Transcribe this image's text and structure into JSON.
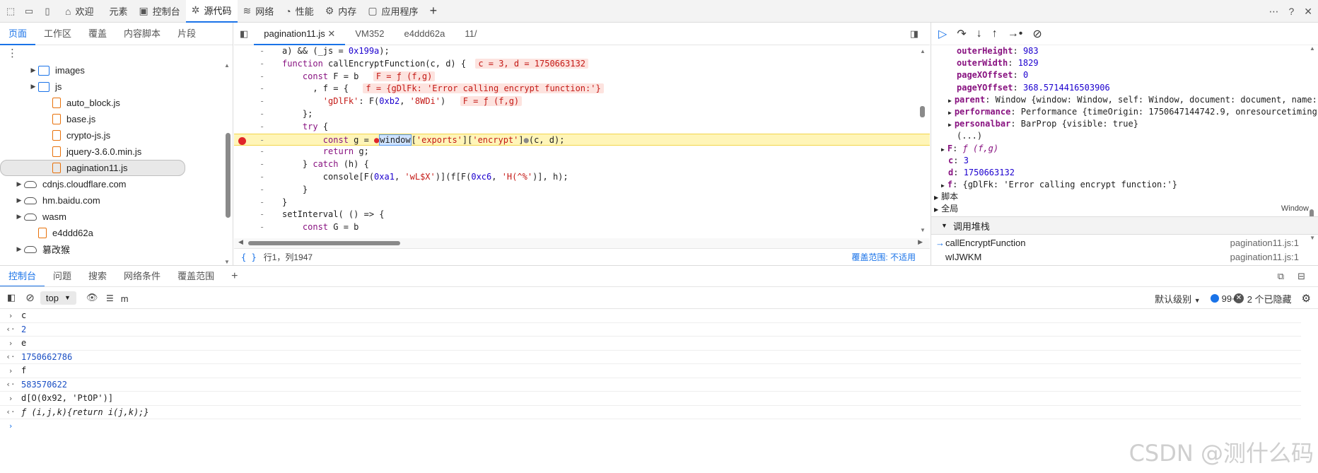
{
  "topbar": {
    "tabs": [
      {
        "label": "欢迎",
        "icon": "home-icon"
      },
      {
        "label": "元素",
        "icon": "code-icon"
      },
      {
        "label": "控制台",
        "icon": "console-icon"
      },
      {
        "label": "源代码",
        "icon": "bug-icon",
        "active": true
      },
      {
        "label": "网络",
        "icon": "wifi-icon"
      },
      {
        "label": "性能",
        "icon": "gauge-icon"
      },
      {
        "label": "内存",
        "icon": "memory-icon"
      },
      {
        "label": "应用程序",
        "icon": "app-icon"
      }
    ]
  },
  "navigator": {
    "tabs": [
      "页面",
      "工作区",
      "覆盖",
      "内容脚本",
      "片段"
    ],
    "tree": [
      {
        "label": "images",
        "type": "folder",
        "indent": 2,
        "arrow": "▶"
      },
      {
        "label": "js",
        "type": "folder",
        "indent": 2,
        "arrow": "▶"
      },
      {
        "label": "auto_block.js",
        "type": "file",
        "indent": 3,
        "arrow": ""
      },
      {
        "label": "base.js",
        "type": "file",
        "indent": 3,
        "arrow": ""
      },
      {
        "label": "crypto-js.js",
        "type": "file",
        "indent": 3,
        "arrow": ""
      },
      {
        "label": "jquery-3.6.0.min.js",
        "type": "file",
        "indent": 3,
        "arrow": ""
      },
      {
        "label": "pagination11.js",
        "type": "file",
        "indent": 3,
        "arrow": "",
        "selected": true
      },
      {
        "label": "cdnjs.cloudflare.com",
        "type": "cloud",
        "indent": 1,
        "arrow": "▶"
      },
      {
        "label": "hm.baidu.com",
        "type": "cloud",
        "indent": 1,
        "arrow": "▶"
      },
      {
        "label": "wasm",
        "type": "cloud",
        "indent": 1,
        "arrow": "▶"
      },
      {
        "label": "e4ddd62a",
        "type": "file",
        "indent": 2,
        "arrow": ""
      },
      {
        "label": "篡改猴",
        "type": "cloud",
        "indent": 1,
        "arrow": "▶"
      }
    ]
  },
  "editor": {
    "tabs": [
      "pagination11.js",
      "VM352",
      "e4ddd62a",
      "11/"
    ],
    "status_pos": "行1，列1947",
    "status_braces": "{ }",
    "coverage": "覆盖范围: 不适用"
  },
  "code_lines": [
    {
      "gut": "-",
      "html": "a) &amp;&amp; (_js = <span class='num'>0x199a</span>);"
    },
    {
      "gut": "-",
      "html": "<span class='kw'>function</span> callEncryptFunction(c, d) { <span class='inl'>c = 3, d = 1750663132</span>"
    },
    {
      "gut": "-",
      "html": "    <span class='kw'>const</span> F = b  <span class='inl'>F = ƒ (f,g)</span>"
    },
    {
      "gut": "-",
      "html": "      , f = {  <span class='inl'>f = {gDlFk: 'Error calling encrypt function:'}</span>"
    },
    {
      "gut": "-",
      "html": "        <span class='str'>'gDlFk'</span>: F(<span class='num'>0xb2</span>, <span class='str'>'8WDi'</span>)  <span class='inl'>F = ƒ (f,g)</span>"
    },
    {
      "gut": "-",
      "html": "    };"
    },
    {
      "gut": "-",
      "html": "    <span class='kw'>try</span> {"
    },
    {
      "gut": "-",
      "html": "        <span class='kw'>const</span> g = <span style='color:#e0262a'>●</span><span class='sel-word'>window</span>[<span class='str'>'exports'</span>][<span class='str'>'encrypt'</span>]<span style='color:#888'>●</span>(c, d);",
      "hl": true,
      "bp": true
    },
    {
      "gut": "-",
      "html": "        <span class='kw'>return</span> g;"
    },
    {
      "gut": "-",
      "html": "    } <span class='kw'>catch</span> (h) {"
    },
    {
      "gut": "-",
      "html": "        console[F(<span class='num'>0xa1</span>, <span class='str'>'wL$X'</span>)](f[F(<span class='num'>0xc6</span>, <span class='str'>'H(^%'</span>)], h);"
    },
    {
      "gut": "-",
      "html": "    }"
    },
    {
      "gut": "-",
      "html": "}"
    },
    {
      "gut": "-",
      "html": "setInterval( () =&gt; {"
    },
    {
      "gut": "-",
      "html": "    <span class='kw'>const</span> G = b"
    }
  ],
  "scope": [
    {
      "indent": 36,
      "key": "outerHeight",
      "val": "983",
      "num": true
    },
    {
      "indent": 36,
      "key": "outerWidth",
      "val": "1829",
      "num": true
    },
    {
      "indent": 36,
      "key": "pageXOffset",
      "val": "0",
      "num": true
    },
    {
      "indent": 36,
      "key": "pageYOffset",
      "val": "368.5714416503906",
      "num": true
    },
    {
      "indent": 24,
      "arrow": "▶",
      "key": "parent",
      "val": "Window {window: Window, self: Window, document: document, name:"
    },
    {
      "indent": 24,
      "arrow": "▶",
      "key": "performance",
      "val": "Performance {timeOrigin: 1750647144742.9, onresourcetiming"
    },
    {
      "indent": 24,
      "arrow": "▶",
      "key": "personalbar",
      "val": "BarProp {visible: true}"
    },
    {
      "indent": 36,
      "key": "",
      "val": "(...)"
    },
    {
      "indent": 14,
      "arrow": "▶",
      "key": "F",
      "val": "ƒ (f,g)"
    },
    {
      "indent": 24,
      "key": "c",
      "val": "3",
      "num": true
    },
    {
      "indent": 24,
      "key": "d",
      "val": "1750663132",
      "num": true
    },
    {
      "indent": 14,
      "arrow": "▶",
      "key": "f",
      "val": "{gDlFk: 'Error calling encrypt function:'}"
    }
  ],
  "scope_sections": [
    {
      "label": "脚本"
    },
    {
      "label": "全局",
      "right": "Window"
    }
  ],
  "callstack": {
    "title": "调用堆栈",
    "frames": [
      {
        "fn": "callEncryptFunction",
        "loc": "pagination11.js:1",
        "current": true
      },
      {
        "fn": "wIJWKM",
        "loc": "pagination11.js:1"
      }
    ]
  },
  "drawer": {
    "tabs": [
      "控制台",
      "问题",
      "搜索",
      "网络条件",
      "覆盖范围"
    ]
  },
  "console_toolbar": {
    "context": "top",
    "filter": "m",
    "level": "默认级别",
    "count": "99+",
    "hidden": "2 个已隐藏"
  },
  "console_rows": [
    {
      "pfx": "›",
      "text": "c",
      "kind": "in"
    },
    {
      "pfx": "‹·",
      "text": "2",
      "kind": "out"
    },
    {
      "pfx": "›",
      "text": "e",
      "kind": "in"
    },
    {
      "pfx": "‹·",
      "text": "1750662786",
      "kind": "out"
    },
    {
      "pfx": "›",
      "text": "f",
      "kind": "in"
    },
    {
      "pfx": "‹·",
      "text": "583570622",
      "kind": "out"
    },
    {
      "pfx": "›",
      "text": "d[O(0x92, 'PtOP')]",
      "kind": "in"
    },
    {
      "pfx": "‹·",
      "text": "ƒ (i,j,k){return i(j,k);}",
      "kind": "fn"
    },
    {
      "pfx": "›",
      "text": "",
      "kind": "prompt"
    }
  ],
  "watermark": "CSDN @测什么码"
}
